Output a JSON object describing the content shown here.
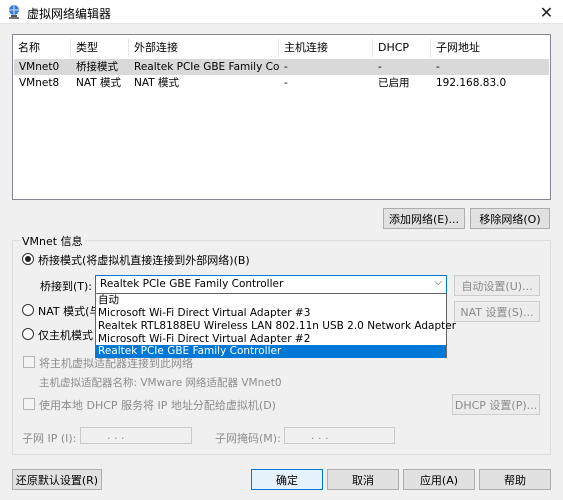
{
  "window": {
    "title": "虚拟网络编辑器"
  },
  "table": {
    "headers": [
      "名称",
      "类型",
      "外部连接",
      "主机连接",
      "DHCP",
      "子网地址"
    ],
    "rows": [
      [
        "VMnet0",
        "桥接模式",
        "Realtek PCIe GBE Family Co...",
        "-",
        "-",
        "-"
      ],
      [
        "VMnet8",
        "NAT 模式",
        "NAT 模式",
        "-",
        "已启用",
        "192.168.83.0"
      ]
    ]
  },
  "buttons": {
    "add_network": "添加网络(E)...",
    "remove_network": "移除网络(O)",
    "auto_settings": "自动设置(U)...",
    "nat_settings": "NAT 设置(S)...",
    "dhcp_settings": "DHCP 设置(P)...",
    "restore_defaults": "还原默认设置(R)",
    "ok": "确定",
    "cancel": "取消",
    "apply": "应用(A)",
    "help": "帮助"
  },
  "vmnet_info": {
    "group_label": "VMnet 信息",
    "bridged_radio": "桥接模式(将虚拟机直接连接到外部网络)(B)",
    "bridge_to_label": "桥接到(T):",
    "bridge_selected": "Realtek PCIe GBE Family Controller",
    "bridge_options": [
      "自动",
      "Microsoft Wi-Fi Direct Virtual Adapter #3",
      "Realtek RTL8188EU Wireless LAN 802.11n USB 2.0 Network Adapter",
      "Microsoft Wi-Fi Direct Virtual Adapter #2",
      "Realtek PCIe GBE Family Controller"
    ],
    "nat_radio": "NAT 模式(与",
    "hostonly_radio": "仅主机模式",
    "connect_host_adapter": "将主机虚拟适配器连接到此网络",
    "host_adapter_name": "主机虚拟适配器名称: VMware 网络适配器 VMnet0",
    "use_dhcp": "使用本地 DHCP 服务将 IP 地址分配给虚拟机(D)",
    "subnet_ip_label": "子网 IP (I):",
    "subnet_mask_label": "子网掩码(M):",
    "ip_dots": ".   .   ."
  }
}
